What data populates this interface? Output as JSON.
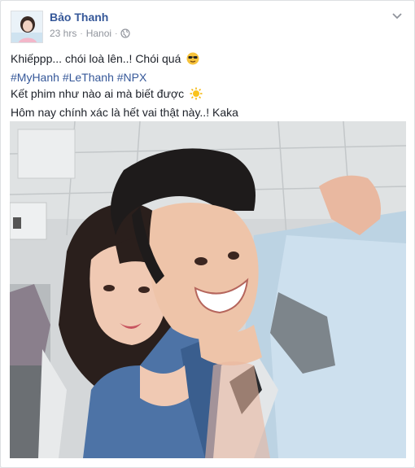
{
  "post": {
    "author": "Bảo Thanh",
    "time": "23 hrs",
    "location": "Hanoi",
    "separator": "·",
    "text": {
      "line1": "Khiếppp... chói loà lên..! Chói quá",
      "hashtags": [
        "#MyHanh",
        "#LeThanh",
        "#NPX"
      ],
      "line3": "Kết phim như nào ai mà biết được",
      "line4": "Hôm nay chính xác là hết vai thật này..! Kaka"
    }
  },
  "icons": {
    "options": "chevron-down-icon",
    "privacy": "globe-icon",
    "emoji1": "sunglasses-face-icon",
    "emoji2": "sun-icon"
  },
  "colors": {
    "link": "#365899",
    "meta": "#90949c",
    "text": "#1d2129"
  }
}
